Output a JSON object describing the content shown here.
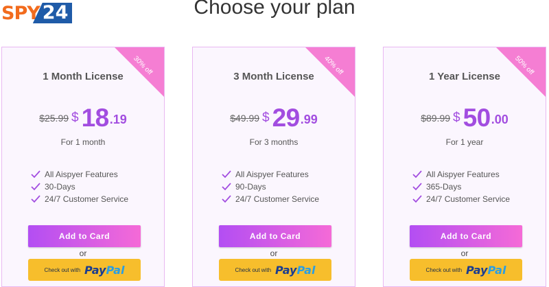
{
  "logo": {
    "spy": "SPY",
    "num": "24"
  },
  "page_title": "Choose your plan",
  "plans": [
    {
      "badge": "30% off",
      "title": "1 Month License",
      "old_price": "$25.99",
      "currency": "$",
      "price_main": "18",
      "price_cents": ".19",
      "period": "For 1 month",
      "features": [
        "All Aispyer Features",
        "30-Days",
        "24/7 Customer Service"
      ],
      "add_label": "Add to Card",
      "or": "or",
      "paypal_prefix": "Check out with",
      "paypal_pay": "Pay",
      "paypal_pal": "Pal"
    },
    {
      "badge": "40% off",
      "title": "3 Month License",
      "old_price": "$49.99",
      "currency": "$",
      "price_main": "29",
      "price_cents": ".99",
      "period": "For 3 months",
      "features": [
        "All Aispyer Features",
        "90-Days",
        "24/7 Customer Service"
      ],
      "add_label": "Add to Card",
      "or": "or",
      "paypal_prefix": "Check out with",
      "paypal_pay": "Pay",
      "paypal_pal": "Pal"
    },
    {
      "badge": "50% off",
      "title": "1 Year License",
      "old_price": "$89.99",
      "currency": "$",
      "price_main": "50",
      "price_cents": ".00",
      "period": "For 1 year",
      "features": [
        "All Aispyer Features",
        "365-Days",
        "24/7 Customer Service"
      ],
      "add_label": "Add to Card",
      "or": "or",
      "paypal_prefix": "Check out with",
      "paypal_pay": "Pay",
      "paypal_pal": "Pal"
    }
  ],
  "colors": {
    "accent": "#a24de0",
    "ribbon": "#f57ed3",
    "button_gradient_start": "#b34ef3",
    "button_gradient_end": "#f56ad7",
    "paypal_button": "#f7be2c",
    "logo_orange": "#f26b1d",
    "logo_blue": "#1f5ba8"
  },
  "icons": {
    "feature": "check-icon"
  }
}
